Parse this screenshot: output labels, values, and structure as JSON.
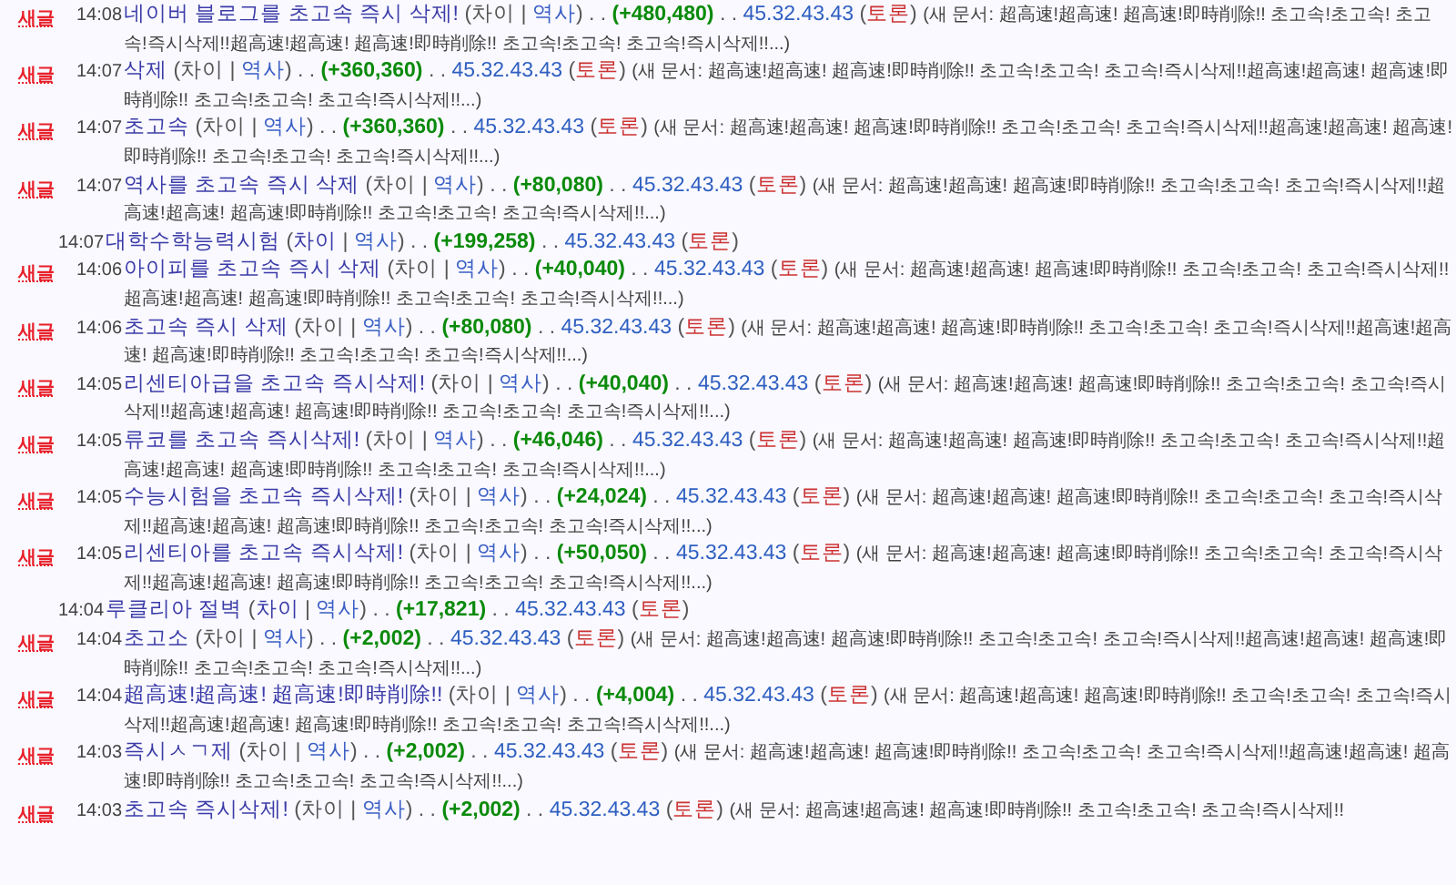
{
  "entries": [
    {
      "badge": "새글",
      "time": "14:08",
      "parts": [
        {
          "kind": "title",
          "text": "네이버 블로그를 초고속 즉시 삭제!"
        },
        {
          "kind": "open",
          "text": "("
        },
        {
          "kind": "diff",
          "text": "차이"
        },
        {
          "kind": "plain",
          "text": "|"
        },
        {
          "kind": "history",
          "text": "역사"
        },
        {
          "kind": "close",
          "text": ")"
        },
        {
          "kind": "plain",
          "text": ". ."
        },
        {
          "kind": "size",
          "text": "(+480,480)"
        },
        {
          "kind": "plain",
          "text": ". ."
        },
        {
          "kind": "user",
          "text": "45.32.43.43"
        },
        {
          "kind": "open",
          "text": "("
        },
        {
          "kind": "talk",
          "text": "토론"
        },
        {
          "kind": "close",
          "text": ")"
        },
        {
          "kind": "comment",
          "text": "(새 문서: 超高速!超高速! 超高速!即時削除!! 초고속!초고속! 초고속!즉시삭제!!超高速!超高速! 超高速!即時削除!! 초고속!초고속! 초고속!즉시삭제!!...)"
        }
      ]
    },
    {
      "badge": "새글",
      "time": "14:07",
      "parts": [
        {
          "kind": "title",
          "text": "삭제"
        },
        {
          "kind": "open",
          "text": "("
        },
        {
          "kind": "diff",
          "text": "차이"
        },
        {
          "kind": "plain",
          "text": "|"
        },
        {
          "kind": "history",
          "text": "역사"
        },
        {
          "kind": "close",
          "text": ")"
        },
        {
          "kind": "plain",
          "text": ". ."
        },
        {
          "kind": "size",
          "text": "(+360,360)"
        },
        {
          "kind": "plain",
          "text": ". ."
        },
        {
          "kind": "user",
          "text": "45.32.43.43"
        },
        {
          "kind": "open",
          "text": "("
        },
        {
          "kind": "talk",
          "text": "토론"
        },
        {
          "kind": "close",
          "text": ")"
        },
        {
          "kind": "comment",
          "text": "(새 문서: 超高速!超高速! 超高速!即時削除!! 초고속!초고속! 초고속!즉시삭제!!超高速!超高速! 超高速!即時削除!! 초고속!초고속! 초고속!즉시삭제!!...)"
        }
      ]
    },
    {
      "badge": "새글",
      "time": "14:07",
      "parts": [
        {
          "kind": "title",
          "text": "초고속"
        },
        {
          "kind": "open",
          "text": "("
        },
        {
          "kind": "diff",
          "text": "차이"
        },
        {
          "kind": "plain",
          "text": "|"
        },
        {
          "kind": "history",
          "text": "역사"
        },
        {
          "kind": "close",
          "text": ")"
        },
        {
          "kind": "plain",
          "text": ". ."
        },
        {
          "kind": "size",
          "text": "(+360,360)"
        },
        {
          "kind": "plain",
          "text": ". ."
        },
        {
          "kind": "user",
          "text": "45.32.43.43"
        },
        {
          "kind": "open",
          "text": "("
        },
        {
          "kind": "talk",
          "text": "토론"
        },
        {
          "kind": "close",
          "text": ")"
        },
        {
          "kind": "comment",
          "text": "(새 문서: 超高速!超高速! 超高速!即時削除!! 초고속!초고속! 초고속!즉시삭제!!超高速!超高速! 超高速!即時削除!! 초고속!초고속! 초고속!즉시삭제!!...)"
        }
      ]
    },
    {
      "badge": "새글",
      "time": "14:07",
      "parts": [
        {
          "kind": "title",
          "text": "역사를 초고속 즉시 삭제"
        },
        {
          "kind": "open",
          "text": "("
        },
        {
          "kind": "diff",
          "text": "차이"
        },
        {
          "kind": "plain",
          "text": "|"
        },
        {
          "kind": "history",
          "text": "역사"
        },
        {
          "kind": "close",
          "text": ")"
        },
        {
          "kind": "plain",
          "text": ". ."
        },
        {
          "kind": "size",
          "text": "(+80,080)"
        },
        {
          "kind": "plain",
          "text": ". ."
        },
        {
          "kind": "user",
          "text": "45.32.43.43"
        },
        {
          "kind": "open",
          "text": "("
        },
        {
          "kind": "talk",
          "text": "토론"
        },
        {
          "kind": "close",
          "text": ")"
        },
        {
          "kind": "comment",
          "text": "(새 문서: 超高速!超高速! 超高速!即時削除!! 초고속!초고속! 초고속!즉시삭제!!超高速!超高速! 超高速!即時削除!! 초고속!초고속! 초고속!즉시삭제!!...)"
        }
      ]
    },
    {
      "time": "14:07",
      "parts": [
        {
          "kind": "title",
          "text": "대학수학능력시험"
        },
        {
          "kind": "open",
          "text": "("
        },
        {
          "kind": "difflink",
          "text": "차이"
        },
        {
          "kind": "plain",
          "text": "|"
        },
        {
          "kind": "history",
          "text": "역사"
        },
        {
          "kind": "close",
          "text": ")"
        },
        {
          "kind": "plain",
          "text": ". ."
        },
        {
          "kind": "size",
          "text": "(+199,258)"
        },
        {
          "kind": "plain",
          "text": ". ."
        },
        {
          "kind": "user",
          "text": "45.32.43.43"
        },
        {
          "kind": "open",
          "text": "("
        },
        {
          "kind": "talk",
          "text": "토론"
        },
        {
          "kind": "close",
          "text": ")"
        }
      ]
    },
    {
      "badge": "새글",
      "time": "14:06",
      "parts": [
        {
          "kind": "title",
          "text": "아이피를 초고속 즉시 삭제"
        },
        {
          "kind": "open",
          "text": "("
        },
        {
          "kind": "diff",
          "text": "차이"
        },
        {
          "kind": "plain",
          "text": "|"
        },
        {
          "kind": "history",
          "text": "역사"
        },
        {
          "kind": "close",
          "text": ")"
        },
        {
          "kind": "plain",
          "text": ". ."
        },
        {
          "kind": "size",
          "text": "(+40,040)"
        },
        {
          "kind": "plain",
          "text": ". ."
        },
        {
          "kind": "user",
          "text": "45.32.43.43"
        },
        {
          "kind": "open",
          "text": "("
        },
        {
          "kind": "talk",
          "text": "토론"
        },
        {
          "kind": "close",
          "text": ")"
        },
        {
          "kind": "comment",
          "text": "(새 문서: 超高速!超高速! 超高速!即時削除!! 초고속!초고속! 초고속!즉시삭제!!超高速!超高速! 超高速!即時削除!! 초고속!초고속! 초고속!즉시삭제!!...)"
        }
      ]
    },
    {
      "badge": "새글",
      "time": "14:06",
      "parts": [
        {
          "kind": "title",
          "text": "초고속 즉시 삭제"
        },
        {
          "kind": "open",
          "text": "("
        },
        {
          "kind": "diff",
          "text": "차이"
        },
        {
          "kind": "plain",
          "text": "|"
        },
        {
          "kind": "history",
          "text": "역사"
        },
        {
          "kind": "close",
          "text": ")"
        },
        {
          "kind": "plain",
          "text": ". ."
        },
        {
          "kind": "size",
          "text": "(+80,080)"
        },
        {
          "kind": "plain",
          "text": ". ."
        },
        {
          "kind": "user",
          "text": "45.32.43.43"
        },
        {
          "kind": "open",
          "text": "("
        },
        {
          "kind": "talk",
          "text": "토론"
        },
        {
          "kind": "close",
          "text": ")"
        },
        {
          "kind": "comment",
          "text": "(새 문서: 超高速!超高速! 超高速!即時削除!! 초고속!초고속! 초고속!즉시삭제!!超高速!超高速! 超高速!即時削除!! 초고속!초고속! 초고속!즉시삭제!!...)"
        }
      ]
    },
    {
      "badge": "새글",
      "time": "14:05",
      "parts": [
        {
          "kind": "title",
          "text": "리센티아급을 초고속 즉시삭제!"
        },
        {
          "kind": "open",
          "text": "("
        },
        {
          "kind": "diff",
          "text": "차이"
        },
        {
          "kind": "plain",
          "text": "|"
        },
        {
          "kind": "history",
          "text": "역사"
        },
        {
          "kind": "close",
          "text": ")"
        },
        {
          "kind": "plain",
          "text": ". ."
        },
        {
          "kind": "size",
          "text": "(+40,040)"
        },
        {
          "kind": "plain",
          "text": ". ."
        },
        {
          "kind": "user",
          "text": "45.32.43.43"
        },
        {
          "kind": "open",
          "text": "("
        },
        {
          "kind": "talk",
          "text": "토론"
        },
        {
          "kind": "close",
          "text": ")"
        },
        {
          "kind": "comment",
          "text": "(새 문서: 超高速!超高速! 超高速!即時削除!! 초고속!초고속! 초고속!즉시삭제!!超高速!超高速! 超高速!即時削除!! 초고속!초고속! 초고속!즉시삭제!!...)"
        }
      ]
    },
    {
      "badge": "새글",
      "time": "14:05",
      "parts": [
        {
          "kind": "title",
          "text": "류코를 초고속 즉시삭제!"
        },
        {
          "kind": "open",
          "text": "("
        },
        {
          "kind": "diff",
          "text": "차이"
        },
        {
          "kind": "plain",
          "text": "|"
        },
        {
          "kind": "history",
          "text": "역사"
        },
        {
          "kind": "close",
          "text": ")"
        },
        {
          "kind": "plain",
          "text": ". ."
        },
        {
          "kind": "size",
          "text": "(+46,046)"
        },
        {
          "kind": "plain",
          "text": ". ."
        },
        {
          "kind": "user",
          "text": "45.32.43.43"
        },
        {
          "kind": "open",
          "text": "("
        },
        {
          "kind": "talk",
          "text": "토론"
        },
        {
          "kind": "close",
          "text": ")"
        },
        {
          "kind": "comment",
          "text": "(새 문서: 超高速!超高速! 超高速!即時削除!! 초고속!초고속! 초고속!즉시삭제!!超高速!超高速! 超高速!即時削除!! 초고속!초고속! 초고속!즉시삭제!!...)"
        }
      ]
    },
    {
      "badge": "새글",
      "time": "14:05",
      "parts": [
        {
          "kind": "title",
          "text": "수능시험을 초고속 즉시삭제!"
        },
        {
          "kind": "open",
          "text": "("
        },
        {
          "kind": "diff",
          "text": "차이"
        },
        {
          "kind": "plain",
          "text": "|"
        },
        {
          "kind": "history",
          "text": "역사"
        },
        {
          "kind": "close",
          "text": ")"
        },
        {
          "kind": "plain",
          "text": ". ."
        },
        {
          "kind": "size",
          "text": "(+24,024)"
        },
        {
          "kind": "plain",
          "text": ". ."
        },
        {
          "kind": "user",
          "text": "45.32.43.43"
        },
        {
          "kind": "open",
          "text": "("
        },
        {
          "kind": "talk",
          "text": "토론"
        },
        {
          "kind": "close",
          "text": ")"
        },
        {
          "kind": "comment",
          "text": "(새 문서: 超高速!超高速! 超高速!即時削除!! 초고속!초고속! 초고속!즉시삭제!!超高速!超高速! 超高速!即時削除!! 초고속!초고속! 초고속!즉시삭제!!...)"
        }
      ]
    },
    {
      "badge": "새글",
      "time": "14:05",
      "parts": [
        {
          "kind": "title",
          "text": "리센티아를 초고속 즉시삭제!"
        },
        {
          "kind": "open",
          "text": "("
        },
        {
          "kind": "diff",
          "text": "차이"
        },
        {
          "kind": "plain",
          "text": "|"
        },
        {
          "kind": "history",
          "text": "역사"
        },
        {
          "kind": "close",
          "text": ")"
        },
        {
          "kind": "plain",
          "text": ". ."
        },
        {
          "kind": "size",
          "text": "(+50,050)"
        },
        {
          "kind": "plain",
          "text": ". ."
        },
        {
          "kind": "user",
          "text": "45.32.43.43"
        },
        {
          "kind": "open",
          "text": "("
        },
        {
          "kind": "talk",
          "text": "토론"
        },
        {
          "kind": "close",
          "text": ")"
        },
        {
          "kind": "comment",
          "text": "(새 문서: 超高速!超高速! 超高速!即時削除!! 초고속!초고속! 초고속!즉시삭제!!超高速!超高速! 超高速!即時削除!! 초고속!초고속! 초고속!즉시삭제!!...)"
        }
      ]
    },
    {
      "time": "14:04",
      "parts": [
        {
          "kind": "title",
          "text": "루클리아 절벽"
        },
        {
          "kind": "open",
          "text": "("
        },
        {
          "kind": "difflink",
          "text": "차이"
        },
        {
          "kind": "plain",
          "text": "|"
        },
        {
          "kind": "history",
          "text": "역사"
        },
        {
          "kind": "close",
          "text": ")"
        },
        {
          "kind": "plain",
          "text": ". ."
        },
        {
          "kind": "size",
          "text": "(+17,821)"
        },
        {
          "kind": "plain",
          "text": ". ."
        },
        {
          "kind": "user",
          "text": "45.32.43.43"
        },
        {
          "kind": "open",
          "text": "("
        },
        {
          "kind": "talk",
          "text": "토론"
        },
        {
          "kind": "close",
          "text": ")"
        }
      ]
    },
    {
      "badge": "새글",
      "time": "14:04",
      "parts": [
        {
          "kind": "title",
          "text": "초고소"
        },
        {
          "kind": "open",
          "text": "("
        },
        {
          "kind": "diff",
          "text": "차이"
        },
        {
          "kind": "plain",
          "text": "|"
        },
        {
          "kind": "history",
          "text": "역사"
        },
        {
          "kind": "close",
          "text": ")"
        },
        {
          "kind": "plain",
          "text": ". ."
        },
        {
          "kind": "size",
          "text": "(+2,002)"
        },
        {
          "kind": "plain",
          "text": ". ."
        },
        {
          "kind": "user",
          "text": "45.32.43.43"
        },
        {
          "kind": "open",
          "text": "("
        },
        {
          "kind": "talk",
          "text": "토론"
        },
        {
          "kind": "close",
          "text": ")"
        },
        {
          "kind": "comment",
          "text": "(새 문서: 超高速!超高速! 超高速!即時削除!! 초고속!초고속! 초고속!즉시삭제!!超高速!超高速! 超高速!即時削除!! 초고속!초고속! 초고속!즉시삭제!!...)"
        }
      ]
    },
    {
      "badge": "새글",
      "time": "14:04",
      "parts": [
        {
          "kind": "title",
          "text": "超高速!超高速! 超高速!即時削除!!"
        },
        {
          "kind": "open",
          "text": "("
        },
        {
          "kind": "diff",
          "text": "차이"
        },
        {
          "kind": "plain",
          "text": "|"
        },
        {
          "kind": "history",
          "text": "역사"
        },
        {
          "kind": "close",
          "text": ")"
        },
        {
          "kind": "plain",
          "text": ". ."
        },
        {
          "kind": "size",
          "text": "(+4,004)"
        },
        {
          "kind": "plain",
          "text": ". ."
        },
        {
          "kind": "user",
          "text": "45.32.43.43"
        },
        {
          "kind": "open",
          "text": "("
        },
        {
          "kind": "talk",
          "text": "토론"
        },
        {
          "kind": "close",
          "text": ")"
        },
        {
          "kind": "comment",
          "text": "(새 문서: 超高速!超高速! 超高速!即時削除!! 초고속!초고속! 초고속!즉시삭제!!超高速!超高速! 超高速!即時削除!! 초고속!초고속! 초고속!즉시삭제!!...)"
        }
      ]
    },
    {
      "badge": "새글",
      "time": "14:03",
      "parts": [
        {
          "kind": "title",
          "text": "즉시ㅅㄱ제"
        },
        {
          "kind": "open",
          "text": "("
        },
        {
          "kind": "diff",
          "text": "차이"
        },
        {
          "kind": "plain",
          "text": "|"
        },
        {
          "kind": "history",
          "text": "역사"
        },
        {
          "kind": "close",
          "text": ")"
        },
        {
          "kind": "plain",
          "text": ". ."
        },
        {
          "kind": "size",
          "text": "(+2,002)"
        },
        {
          "kind": "plain",
          "text": ". ."
        },
        {
          "kind": "user",
          "text": "45.32.43.43"
        },
        {
          "kind": "open",
          "text": "("
        },
        {
          "kind": "talk",
          "text": "토론"
        },
        {
          "kind": "close",
          "text": ")"
        },
        {
          "kind": "comment",
          "text": "(새 문서: 超高速!超高速! 超高速!即時削除!! 초고속!초고속! 초고속!즉시삭제!!超高速!超高速! 超高速!即時削除!! 초고속!초고속! 초고속!즉시삭제!!...)"
        }
      ]
    },
    {
      "badge": "새글",
      "time": "14:03",
      "parts": [
        {
          "kind": "title",
          "text": "초고속 즉시삭제!"
        },
        {
          "kind": "open",
          "text": "("
        },
        {
          "kind": "diff",
          "text": "차이"
        },
        {
          "kind": "plain",
          "text": "|"
        },
        {
          "kind": "history",
          "text": "역사"
        },
        {
          "kind": "close",
          "text": ")"
        },
        {
          "kind": "plain",
          "text": ". ."
        },
        {
          "kind": "size",
          "text": "(+2,002)"
        },
        {
          "kind": "plain",
          "text": ". ."
        },
        {
          "kind": "user",
          "text": "45.32.43.43"
        },
        {
          "kind": "open",
          "text": "("
        },
        {
          "kind": "talk",
          "text": "토론"
        },
        {
          "kind": "close",
          "text": ")"
        },
        {
          "kind": "comment",
          "text": "(새 문서: 超高速!超高速! 超高速!即時削除!! 초고속!초고속! 초고속!즉시삭제!!"
        }
      ]
    }
  ]
}
